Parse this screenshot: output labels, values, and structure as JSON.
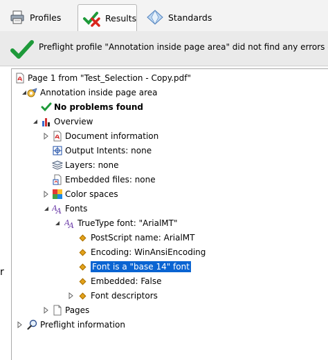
{
  "tabs": [
    {
      "label": "Profiles",
      "icon": "printer-icon"
    },
    {
      "label": "Results",
      "icon": "check-cross-icon"
    },
    {
      "label": "Standards",
      "icon": "diamond-icon"
    }
  ],
  "banner": {
    "message": "Preflight profile \"Annotation inside page area\" did not find any errors or warnings"
  },
  "tree": {
    "page": "Page 1 from \"Test_Selection - Copy.pdf\"",
    "profile": "Annotation inside page area",
    "no_problems": "No problems found",
    "overview": "Overview",
    "doc_info": "Document information",
    "output_intents": "Output Intents: none",
    "layers": "Layers: none",
    "embedded_files": "Embedded files: none",
    "color_spaces": "Color spaces",
    "fonts": "Fonts",
    "truetype": "TrueType font: \"ArialMT\"",
    "postscript": "PostScript name: ArialMT",
    "encoding": "Encoding: WinAnsiEncoding",
    "base14": "Font is a \"base 14\" font",
    "embedded": "Embedded: False",
    "descriptors": "Font descriptors",
    "pages": "Pages",
    "preflight_info": "Preflight information"
  },
  "left_edge_glyph": "r"
}
